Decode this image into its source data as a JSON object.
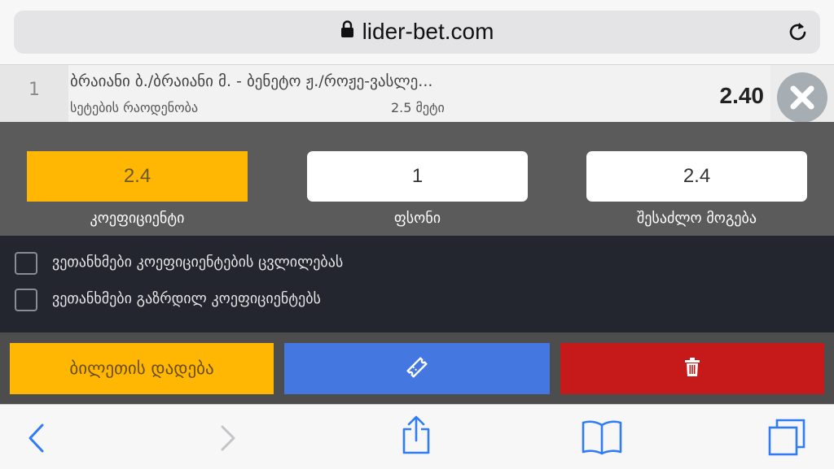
{
  "browser": {
    "url": "lider-bet.com",
    "icons": {
      "lock": "lock-icon",
      "reload": "reload-icon",
      "back": "back-icon",
      "forward": "forward-icon",
      "share": "share-icon",
      "bookmarks": "bookmarks-icon",
      "tabs": "tabs-icon"
    }
  },
  "bet": {
    "index": "1",
    "title": "ბრაიანი ბ./ბრაიანი მ. - ბენეტო ჟ./როჟე-ვასლე...",
    "market": "სეტების რაოდენობა",
    "pick": "2.5 მეტი",
    "odds": "2.40"
  },
  "slip": {
    "odds_value": "2.4",
    "odds_label": "კოეფიციენტი",
    "stake_value": "1",
    "stake_label": "ფსონი",
    "win_value": "2.4",
    "win_label": "შესაძლო მოგება"
  },
  "options": [
    {
      "label": "ვეთანხმები კოეფიციენტების ცვლილებას",
      "checked": false
    },
    {
      "label": "ვეთანხმები გაზრდილ კოეფიციენტებს",
      "checked": false
    }
  ],
  "actions": {
    "place_label": "ბილეთის დადება"
  },
  "colors": {
    "accent_yellow": "#ffb703",
    "accent_blue": "#4477e0",
    "accent_red": "#c5191a",
    "ios_blue": "#2f7cf6"
  }
}
